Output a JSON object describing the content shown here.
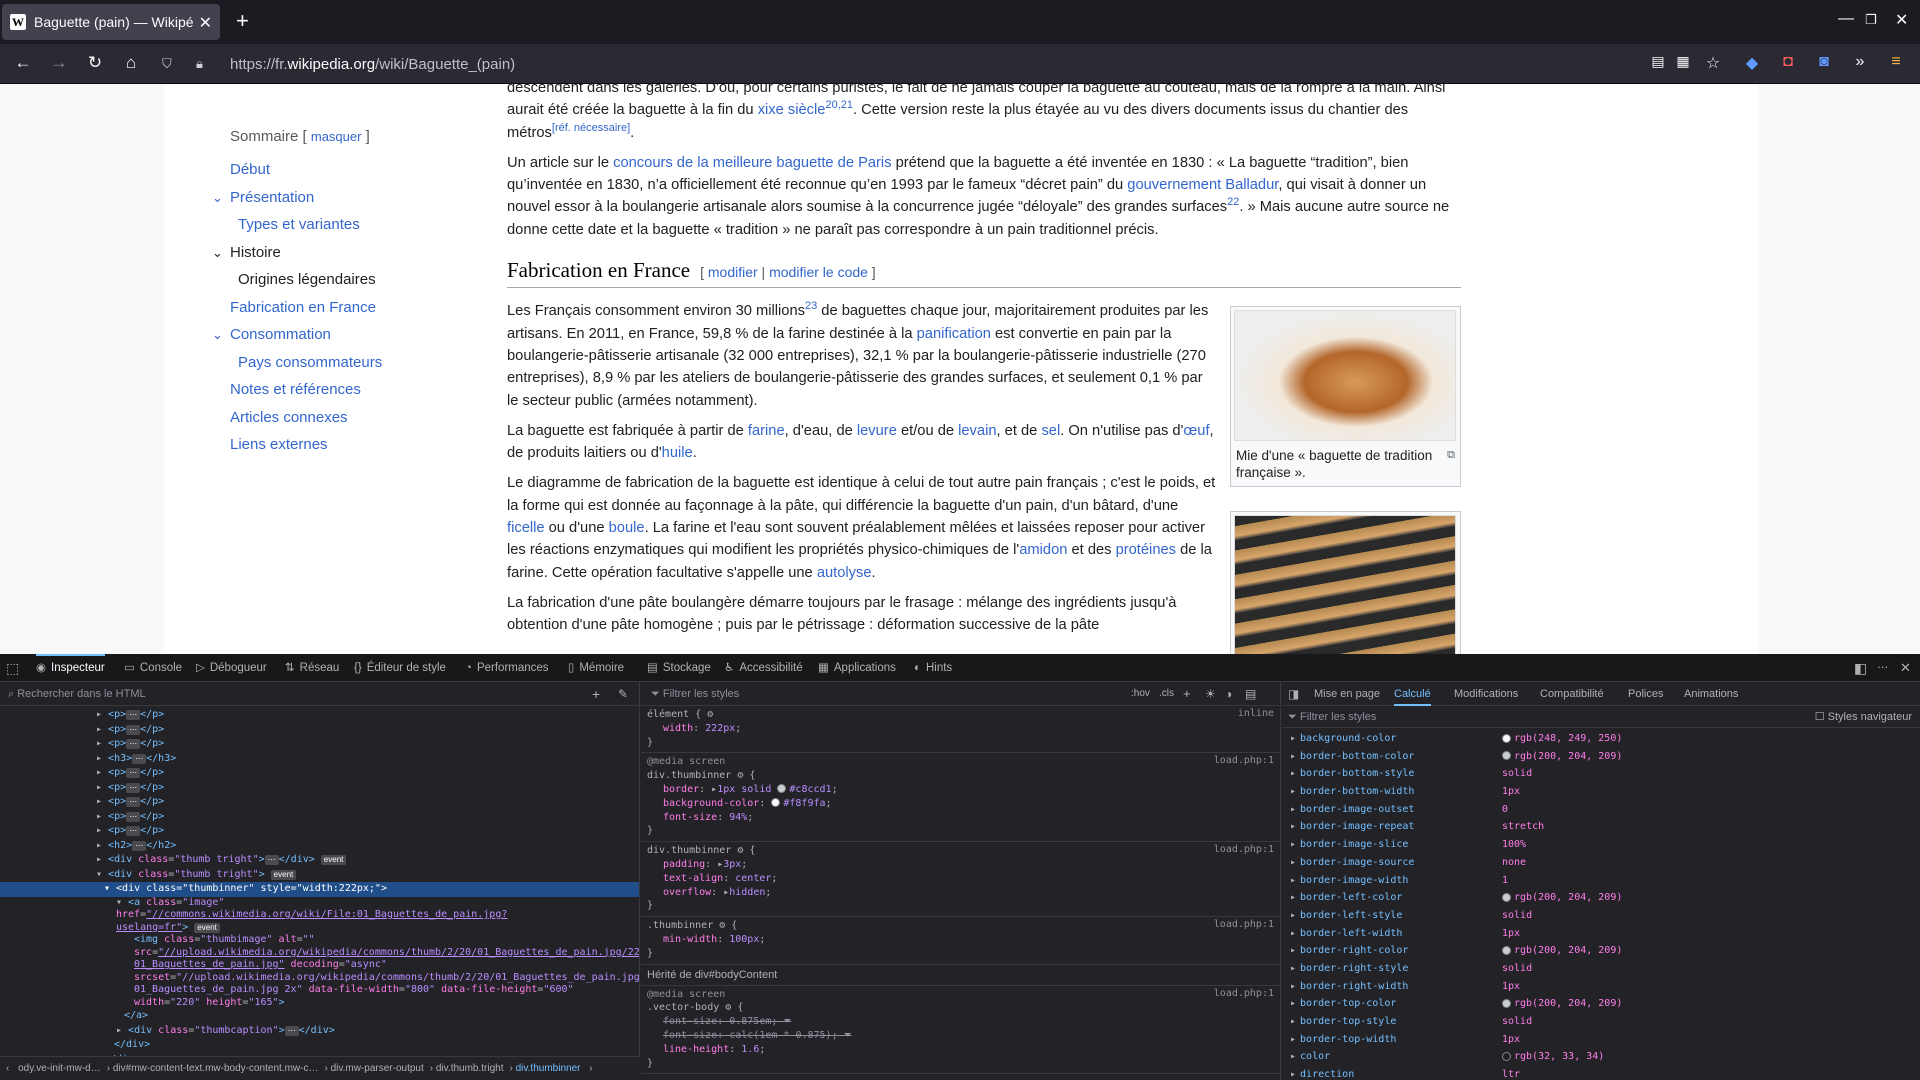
{
  "browser": {
    "tab_title": "Baguette (pain) — Wikipédia",
    "favicon": "W",
    "url_prefix": "https://fr.",
    "url_domain": "wikipedia.org",
    "url_path": "/wiki/Baguette_(pain)"
  },
  "toc": {
    "title": "Sommaire",
    "toggle": "masquer",
    "items": [
      {
        "label": "Début",
        "level": 1,
        "expanded": null
      },
      {
        "label": "Présentation",
        "level": 1,
        "expanded": true
      },
      {
        "label": "Types et variantes",
        "level": 2,
        "expanded": null
      },
      {
        "label": "Histoire",
        "level": 1,
        "expanded": true
      },
      {
        "label": "Origines légendaires",
        "level": 2,
        "expanded": null
      },
      {
        "label": "Fabrication en France",
        "level": 1,
        "expanded": null
      },
      {
        "label": "Consommation",
        "level": 1,
        "expanded": true
      },
      {
        "label": "Pays consommateurs",
        "level": 2,
        "expanded": null
      },
      {
        "label": "Notes et références",
        "level": 1,
        "expanded": null
      },
      {
        "label": "Articles connexes",
        "level": 1,
        "expanded": null
      },
      {
        "label": "Liens externes",
        "level": 1,
        "expanded": null
      }
    ]
  },
  "article": {
    "p1_a": "descendent dans les galeries. D'où, pour certains puristes, le fait de ne jamais couper la baguette au couteau, mais de la rompre à la main. Ainsi aurait été créée la baguette à la fin du ",
    "p1_link": "xixe siècle",
    "p1_sup": "20,21",
    "p1_b": ". Cette version reste la plus étayée au vu des divers documents issus du chantier des métros",
    "p1_ref": "[réf. nécessaire]",
    "p1_end": ".",
    "p2_a": "Un article sur le ",
    "p2_link1": "concours de la meilleure baguette de Paris",
    "p2_b": " prétend que la baguette a été inventée en 1830 : « La baguette “tradition”, bien qu’inventée en 1830, n’a officiellement été reconnue qu’en 1993 par le fameux “décret pain” du ",
    "p2_link2": "gouvernement Balladur",
    "p2_c": ", qui visait à donner un nouvel essor à la boulangerie artisanale alors soumise à la concurrence jugée “déloyale” des grandes surfaces",
    "p2_sup": "22",
    "p2_d": ". » Mais aucune autre source ne donne cette date et la baguette « tradition » ne paraît pas correspondre à un pain traditionnel précis.",
    "h2": "Fabrication en France",
    "h2_edit": "modifier",
    "h2_edit_code": "modifier le code",
    "p3_a": "Les Français consomment environ 30 millions",
    "p3_sup": "23",
    "p3_b": " de baguettes chaque jour, majoritairement produites par les artisans. En 2011, en France, 59,8 % de la farine destinée à la ",
    "p3_link": "panification",
    "p3_c": " est convertie en pain par la boulangerie-pâtisserie artisanale (32 000 entreprises), 32,1 % par la boulangerie-pâtisserie industrielle (270 entreprises), 8,9 % par les ateliers de boulangerie-pâtisserie des grandes surfaces, et seulement 0,1 % par le secteur public (armées notamment).",
    "p4_a": "La baguette est fabriquée à partir de ",
    "p4_l1": "farine",
    "p4_b": ", d'eau, de ",
    "p4_l2": "levure",
    "p4_c": " et/ou de ",
    "p4_l3": "levain",
    "p4_d": ", et de ",
    "p4_l4": "sel",
    "p4_e": ". On n'utilise pas d'",
    "p4_l5": "œuf",
    "p4_f": ", de produits laitiers ou d'",
    "p4_l6": "huile",
    "p4_g": ".",
    "p5_a": "Le diagramme de fabrication de la baguette est identique à celui de tout autre pain français ; c'est le poids, et la forme qui est donnée au façonnage à la pâte, qui différencie la baguette d'un pain, d'un bâtard, d'une ",
    "p5_l1": "ficelle",
    "p5_b": " ou d'une ",
    "p5_l2": "boule",
    "p5_c": ". La farine et l'eau sont souvent préalablement mêlées et laissées reposer pour activer les réactions enzymatiques qui modifient les propriétés physico-chimiques de l'",
    "p5_l3": "amidon",
    "p5_d": " et des ",
    "p5_l4": "protéines",
    "p5_e": " de la farine. Cette opération facultative s'appelle une ",
    "p5_l5": "autolyse",
    "p5_f": ".",
    "p6": "La fabrication d'une pâte boulangère démarre toujours par le frasage : mélange des ingrédients jusqu'à obtention d'une pâte homogène ; puis par le pétrissage : déformation successive de la pâte",
    "thumb1_caption": "Mie d'une « baguette de tradition française »."
  },
  "devtools": {
    "tabs": [
      "Inspecteur",
      "Console",
      "Débogueur",
      "Réseau",
      "Éditeur de style",
      "Performances",
      "Mémoire",
      "Stockage",
      "Accessibilité",
      "Applications",
      "Hints"
    ],
    "search_placeholder": "Rechercher dans le HTML",
    "rules_filter": "Filtrer les styles",
    "hov": ":hov",
    "cls": ".cls",
    "computed_tabs": [
      "Mise en page",
      "Calculé",
      "Modifications",
      "Compatibilité",
      "Polices",
      "Animations"
    ],
    "computed_filter": "Filtrer les styles",
    "browser_styles": "Styles navigateur",
    "breadcrumbs": [
      "ody.ve-init-mw-d…",
      "div#mw-content-text.mw-body-content.mw-c…",
      "div.mw-parser-output",
      "div.thumb.tright",
      "div.thumbinner"
    ],
    "inherited_label": "Hérité de div#bodyContent",
    "computed": [
      {
        "name": "background-color",
        "value": "rgb(248, 249, 250)",
        "swatch": "#f8f9fa"
      },
      {
        "name": "border-bottom-color",
        "value": "rgb(200, 204, 209)",
        "swatch": "#c8ccd1"
      },
      {
        "name": "border-bottom-style",
        "value": "solid",
        "swatch": null
      },
      {
        "name": "border-bottom-width",
        "value": "1px",
        "swatch": null
      },
      {
        "name": "border-image-outset",
        "value": "0",
        "swatch": null
      },
      {
        "name": "border-image-repeat",
        "value": "stretch",
        "swatch": null
      },
      {
        "name": "border-image-slice",
        "value": "100%",
        "swatch": null
      },
      {
        "name": "border-image-source",
        "value": "none",
        "swatch": null
      },
      {
        "name": "border-image-width",
        "value": "1",
        "swatch": null
      },
      {
        "name": "border-left-color",
        "value": "rgb(200, 204, 209)",
        "swatch": "#c8ccd1"
      },
      {
        "name": "border-left-style",
        "value": "solid",
        "swatch": null
      },
      {
        "name": "border-left-width",
        "value": "1px",
        "swatch": null
      },
      {
        "name": "border-right-color",
        "value": "rgb(200, 204, 209)",
        "swatch": "#c8ccd1"
      },
      {
        "name": "border-right-style",
        "value": "solid",
        "swatch": null
      },
      {
        "name": "border-right-width",
        "value": "1px",
        "swatch": null
      },
      {
        "name": "border-top-color",
        "value": "rgb(200, 204, 209)",
        "swatch": "#c8ccd1"
      },
      {
        "name": "border-top-style",
        "value": "solid",
        "swatch": null
      },
      {
        "name": "border-top-width",
        "value": "1px",
        "swatch": null
      },
      {
        "name": "color",
        "value": "rgb(32, 33, 34)",
        "swatch": "#202122"
      },
      {
        "name": "direction",
        "value": "ltr",
        "swatch": null
      }
    ]
  },
  "colors": {
    "link": "#3366cc",
    "devtools_bg": "#232327",
    "selection": "#204e8a",
    "accent": "#75bfff"
  }
}
